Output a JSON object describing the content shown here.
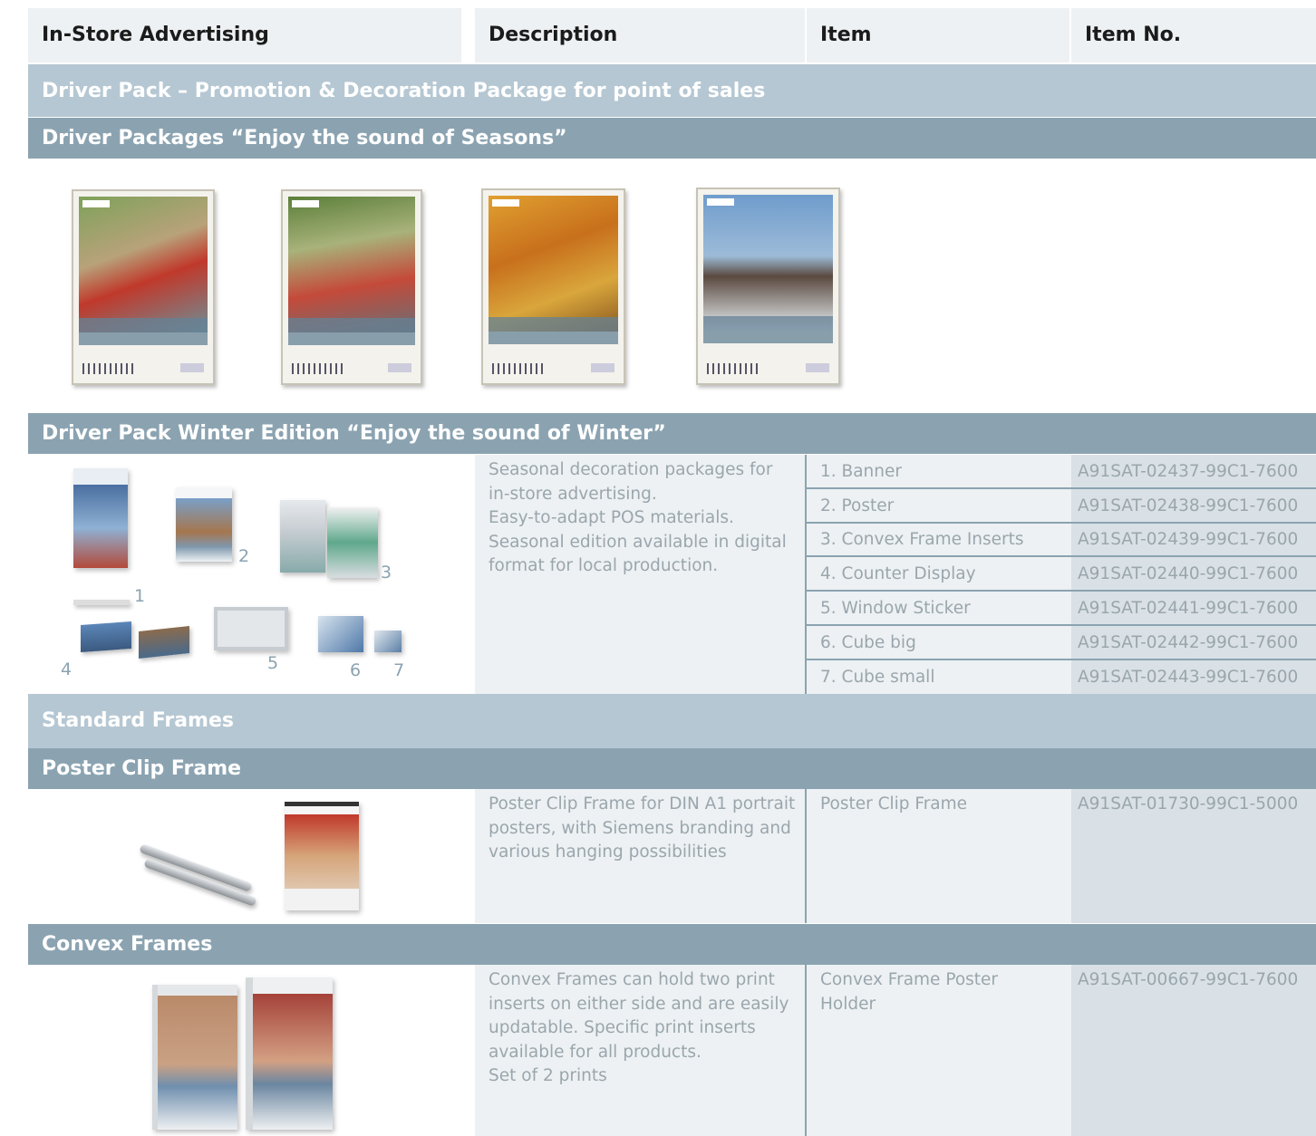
{
  "header": {
    "col1": "In-Store Advertising",
    "col2": "Description",
    "col3": "Item",
    "col4": "Item No."
  },
  "sections": {
    "driver_pack": "Driver Pack – Promotion & Decoration Package for point of sales",
    "driver_packages": "Driver Packages “Enjoy the sound of Seasons”",
    "winter": "Driver Pack Winter Edition “Enjoy the sound of Winter”",
    "standard_frames": "Standard Frames",
    "poster_clip": "Poster Clip Frame",
    "convex": "Convex Frames"
  },
  "winter": {
    "description": "Seasonal decoration packages for in-store advertising. Easy-to-adapt POS materials. Seasonal edition available in digital format for local production.",
    "description_lines": [
      "Seasonal decoration packages for",
      "in-store advertising.",
      "Easy-to-adapt POS materials.",
      "Seasonal edition available in digital",
      "format for local production."
    ],
    "image_numbers": [
      "1",
      "2",
      "3",
      "4",
      "5",
      "6",
      "7"
    ],
    "items": [
      {
        "item": "1. Banner",
        "no": "A91SAT-02437-99C1-7600"
      },
      {
        "item": "2. Poster",
        "no": "A91SAT-02438-99C1-7600"
      },
      {
        "item": "3. Convex Frame Inserts",
        "no": "A91SAT-02439-99C1-7600"
      },
      {
        "item": "4. Counter Display",
        "no": "A91SAT-02440-99C1-7600"
      },
      {
        "item": "5. Window Sticker",
        "no": "A91SAT-02441-99C1-7600"
      },
      {
        "item": "6. Cube big",
        "no": "A91SAT-02442-99C1-7600"
      },
      {
        "item": "7. Cube small",
        "no": "A91SAT-02443-99C1-7600"
      }
    ]
  },
  "poster_clip": {
    "description_lines": [
      "Poster Clip Frame for DIN A1 portrait",
      "posters, with Siemens branding and",
      "various hanging possibilities"
    ],
    "item": "Poster Clip Frame",
    "no": "A91SAT-01730-99C1-5000"
  },
  "convex": {
    "description_lines": [
      "Convex Frames can hold two print",
      "inserts on either side and are easily",
      "updatable. Specific print inserts",
      "available for all products.",
      "Set of 2 prints"
    ],
    "item_lines": [
      "Convex Frame Poster",
      "Holder"
    ],
    "no": "A91SAT-00667-99C1-7600"
  },
  "colors": {
    "header_bg": "#edf1f3",
    "band_light": "#b5c7d2",
    "band_dark": "#8ba3b1",
    "text_muted": "#9aa6ad"
  }
}
